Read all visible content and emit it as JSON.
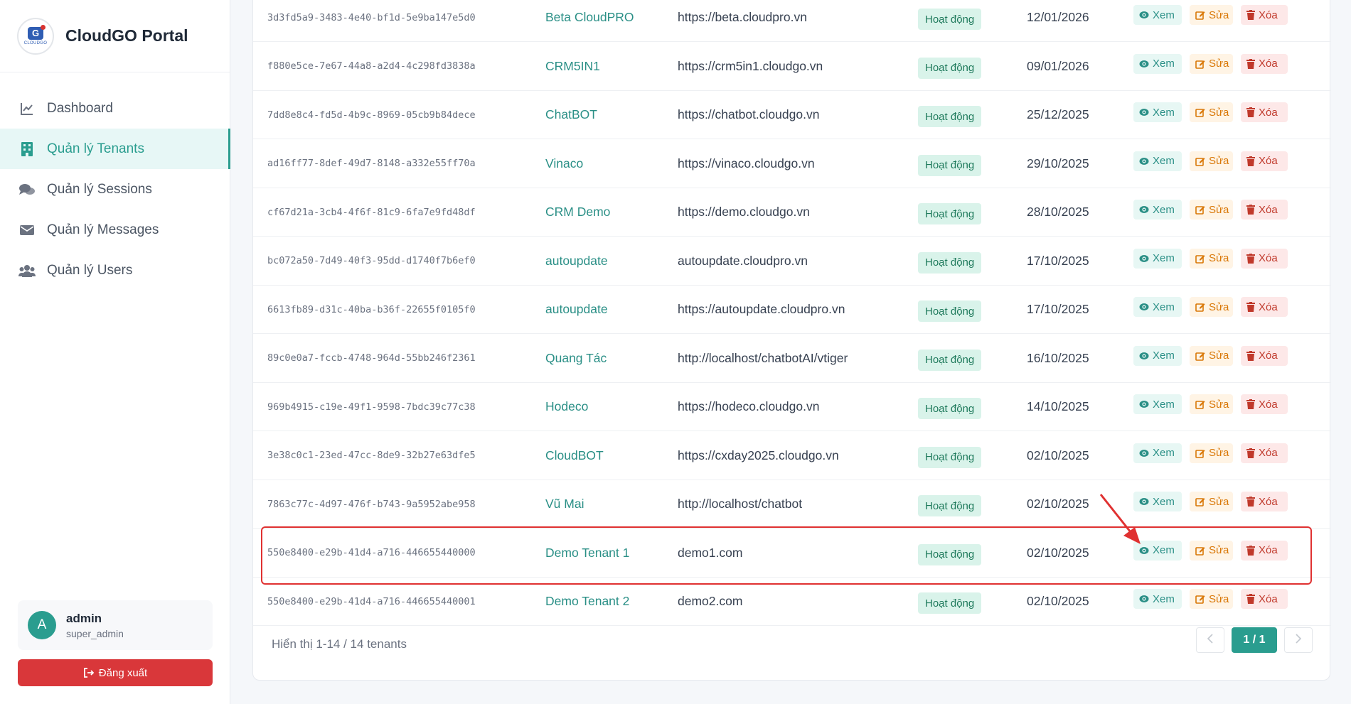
{
  "brand": {
    "name": "CloudGO Portal",
    "logo_text": "CLOUDGO",
    "logo_letter": "G"
  },
  "nav": [
    {
      "label": "Dashboard",
      "icon": "chart-line-icon",
      "active": false
    },
    {
      "label": "Quản lý Tenants",
      "icon": "building-icon",
      "active": true
    },
    {
      "label": "Quản lý Sessions",
      "icon": "comments-icon",
      "active": false
    },
    {
      "label": "Quản lý Messages",
      "icon": "envelope-icon",
      "active": false
    },
    {
      "label": "Quản lý Users",
      "icon": "users-icon",
      "active": false
    }
  ],
  "user": {
    "initial": "A",
    "name": "admin",
    "role": "super_admin"
  },
  "logout_label": "Đăng xuất",
  "actions": {
    "view": "Xem",
    "edit": "Sửa",
    "delete": "Xóa"
  },
  "rows": [
    {
      "id": "3d3fd5a9-3483-4e40-bf1d-5e9ba147e5d0",
      "name": "Beta CloudPRO",
      "url": "https://beta.cloudpro.vn",
      "status": "Hoạt động",
      "date": "12/01/2026"
    },
    {
      "id": "f880e5ce-7e67-44a8-a2d4-4c298fd3838a",
      "name": "CRM5IN1",
      "url": "https://crm5in1.cloudgo.vn",
      "status": "Hoạt động",
      "date": "09/01/2026"
    },
    {
      "id": "7dd8e8c4-fd5d-4b9c-8969-05cb9b84dece",
      "name": "ChatBOT",
      "url": "https://chatbot.cloudgo.vn",
      "status": "Hoạt động",
      "date": "25/12/2025"
    },
    {
      "id": "ad16ff77-8def-49d7-8148-a332e55ff70a",
      "name": "Vinaco",
      "url": "https://vinaco.cloudgo.vn",
      "status": "Hoạt động",
      "date": "29/10/2025"
    },
    {
      "id": "cf67d21a-3cb4-4f6f-81c9-6fa7e9fd48df",
      "name": "CRM Demo",
      "url": "https://demo.cloudgo.vn",
      "status": "Hoạt động",
      "date": "28/10/2025"
    },
    {
      "id": "bc072a50-7d49-40f3-95dd-d1740f7b6ef0",
      "name": "autoupdate",
      "url": "autoupdate.cloudpro.vn",
      "status": "Hoạt động",
      "date": "17/10/2025"
    },
    {
      "id": "6613fb89-d31c-40ba-b36f-22655f0105f0",
      "name": "autoupdate",
      "url": "https://autoupdate.cloudpro.vn",
      "status": "Hoạt động",
      "date": "17/10/2025"
    },
    {
      "id": "89c0e0a7-fccb-4748-964d-55bb246f2361",
      "name": "Quang Tác",
      "url": "http://localhost/chatbotAI/vtiger",
      "status": "Hoạt động",
      "date": "16/10/2025"
    },
    {
      "id": "969b4915-c19e-49f1-9598-7bdc39c77c38",
      "name": "Hodeco",
      "url": "https://hodeco.cloudgo.vn",
      "status": "Hoạt động",
      "date": "14/10/2025"
    },
    {
      "id": "3e38c0c1-23ed-47cc-8de9-32b27e63dfe5",
      "name": "CloudBOT",
      "url": "https://cxday2025.cloudgo.vn",
      "status": "Hoạt động",
      "date": "02/10/2025"
    },
    {
      "id": "7863c77c-4d97-476f-b743-9a5952abe958",
      "name": "Vũ Mai",
      "url": "http://localhost/chatbot",
      "status": "Hoạt động",
      "date": "02/10/2025"
    },
    {
      "id": "550e8400-e29b-41d4-a716-446655440000",
      "name": "Demo Tenant 1",
      "url": "demo1.com",
      "status": "Hoạt động",
      "date": "02/10/2025"
    },
    {
      "id": "550e8400-e29b-41d4-a716-446655440001",
      "name": "Demo Tenant 2",
      "url": "demo2.com",
      "status": "Hoạt động",
      "date": "02/10/2025"
    }
  ],
  "footer": {
    "summary": "Hiển thị 1-14 / 14 tenants",
    "page": "1 / 1"
  },
  "colors": {
    "accent": "#2a9d8f",
    "danger": "#d9373a",
    "highlight": "#e03131"
  }
}
